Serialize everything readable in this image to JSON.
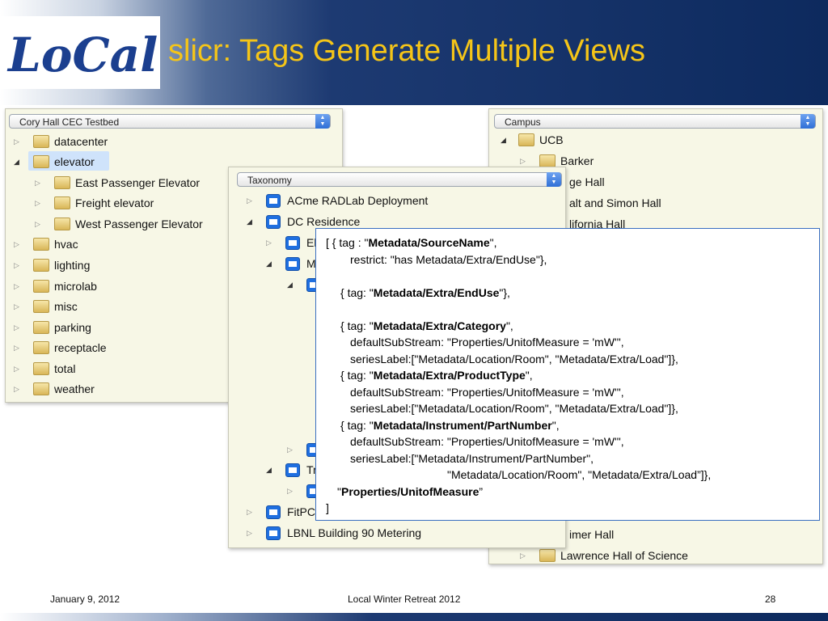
{
  "header": {
    "logo_text": "LoCal",
    "title": "slicr: Tags Generate Multiple Views"
  },
  "window_left": {
    "combo": "Cory Hall CEC Testbed",
    "items": [
      {
        "label": "datacenter"
      },
      {
        "label": "elevator"
      },
      {
        "label": "East Passenger Elevator"
      },
      {
        "label": "Freight elevator"
      },
      {
        "label": "West Passenger Elevator"
      },
      {
        "label": "hvac"
      },
      {
        "label": "lighting"
      },
      {
        "label": "microlab"
      },
      {
        "label": "misc"
      },
      {
        "label": "parking"
      },
      {
        "label": "receptacle"
      },
      {
        "label": "total"
      },
      {
        "label": "weather"
      }
    ]
  },
  "window_right": {
    "combo": "Campus",
    "items": [
      {
        "label": "UCB"
      },
      {
        "label": "Barker"
      },
      {
        "label": "ge Hall"
      },
      {
        "label": "alt and Simon Hall"
      },
      {
        "label": "lifornia Hall"
      },
      {
        "label": "imer Hall"
      },
      {
        "label": "Lawrence Hall of Science"
      }
    ]
  },
  "window_middle": {
    "combo": "Taxonomy",
    "items": [
      {
        "label": "ACme RADLab Deployment"
      },
      {
        "label": "DC Residence"
      },
      {
        "label": "El"
      },
      {
        "label": "M"
      },
      {
        "label": "Tr"
      },
      {
        "label": "FitPC"
      },
      {
        "label": "LBNL Building 90 Metering"
      }
    ]
  },
  "code": {
    "l1a": "[ { tag : \"",
    "l1b": "Metadata/SourceName",
    "l1c": "\",",
    "l2": "restrict: \"has Metadata/Extra/EndUse\"},",
    "l3a": "{ tag: \"",
    "l3b": "Metadata/Extra/EndUse",
    "l3c": "\"},",
    "l4a": "{ tag: \"",
    "l4b": "Metadata/Extra/Category",
    "l4c": "\",",
    "l5": "defaultSubStream: \"Properties/UnitofMeasure = 'mW'\",",
    "l6": "seriesLabel:[\"Metadata/Location/Room\", \"Metadata/Extra/Load\"]},",
    "l7a": "{ tag: \"",
    "l7b": "Metadata/Extra/ProductType",
    "l7c": "\",",
    "l8": "defaultSubStream: \"Properties/UnitofMeasure = 'mW'\",",
    "l9": "seriesLabel:[\"Metadata/Location/Room\", \"Metadata/Extra/Load\"]},",
    "l10a": "{ tag: \"",
    "l10b": "Metadata/Instrument/PartNumber",
    "l10c": "\",",
    "l11": "defaultSubStream: \"Properties/UnitofMeasure = 'mW'\",",
    "l12": "seriesLabel:[\"Metadata/Instrument/PartNumber\",",
    "l13": "\"Metadata/Location/Room\", \"Metadata/Extra/Load”]},",
    "l14a": "\"",
    "l14b": "Properties/UnitofMeasure",
    "l14c": "”",
    "l15": "]"
  },
  "footer": {
    "date": "January 9, 2012",
    "event": "Local Winter Retreat 2012",
    "page": "28"
  },
  "colors": {
    "title": "#f5c518",
    "header_dark": "#0d2a5e",
    "logo": "#1b3f8f",
    "code_border": "#3a6fc1"
  }
}
